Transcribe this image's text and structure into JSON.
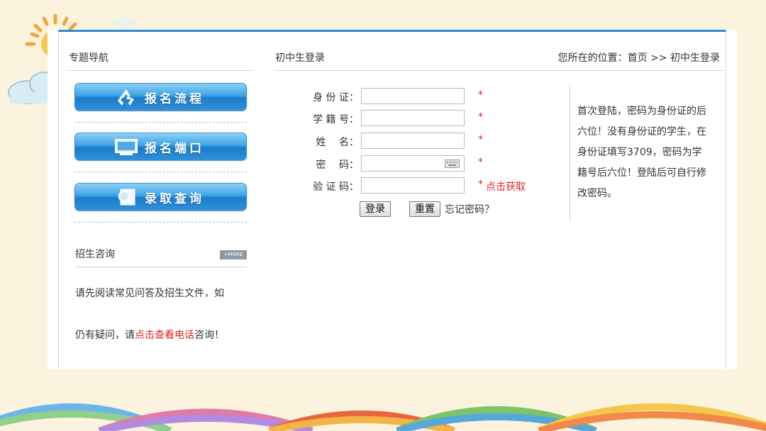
{
  "colors": {
    "accent": "#2f8ad6",
    "red": "#e02020",
    "button_blue": "#2f8fd8",
    "background": "#fbf3de"
  },
  "sidebar": {
    "title": "专题导航",
    "buttons": [
      {
        "label": "报名流程",
        "icon": "recycle-icon"
      },
      {
        "label": "报名端口",
        "icon": "monitor-icon"
      },
      {
        "label": "录取查询",
        "icon": "magnifier-icon"
      }
    ],
    "consult": {
      "title": "招生咨询",
      "more_label": "+MORE",
      "text_line1": "请先阅读常见问答及招生文件，如",
      "text_line2_before": "仍有疑问，请",
      "text_line2_link": "点击查看电话",
      "text_line2_after": "咨询！"
    }
  },
  "main": {
    "title": "初中生登录",
    "breadcrumb": {
      "prefix": "您所在的位置：",
      "home": "首页",
      "sep": " >> ",
      "current": "初中生登录"
    },
    "form": {
      "fields": [
        {
          "label": "身 份 证：",
          "value": "",
          "required": "*"
        },
        {
          "label": "学 籍 号：",
          "value": "",
          "required": "*"
        },
        {
          "label": "姓　 名：",
          "value": "",
          "required": "*"
        },
        {
          "label": "密　 码：",
          "value": "",
          "required": "*"
        },
        {
          "label": "验 证 码：",
          "value": "",
          "required": "*"
        }
      ],
      "captcha_link": "点击获取",
      "login_label": "登录",
      "reset_label": "重置",
      "forgot_label": "忘记密码？"
    },
    "info_lines": [
      "首次登陆，密码为身份证的后",
      "六位！没有身份证的学生，在",
      "身份证填写3709，密码为学",
      "籍号后六位！登陆后可自行修",
      "改密码。"
    ]
  }
}
